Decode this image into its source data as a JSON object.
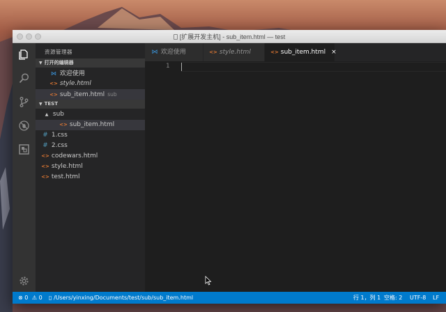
{
  "window": {
    "title": "[扩展开发主机] - sub_item.html — test"
  },
  "activity_bar": {
    "icons": [
      "files-icon",
      "search-icon",
      "source-control-icon",
      "debug-icon",
      "extensions-icon",
      "settings-gear-icon"
    ]
  },
  "sidebar": {
    "title": "资源管理器",
    "open_editors": {
      "header": "打开的编辑器",
      "items": [
        {
          "icon": "vscode-icon",
          "label": "欢迎使用",
          "italic": false,
          "hint": ""
        },
        {
          "icon": "html-icon",
          "label": "style.html",
          "italic": true,
          "hint": ""
        },
        {
          "icon": "html-icon",
          "label": "sub_item.html",
          "italic": false,
          "hint": "sub"
        }
      ]
    },
    "folder": {
      "header": "TEST",
      "items": [
        {
          "icon": "folder-open-icon",
          "label": "sub",
          "depth": 1
        },
        {
          "icon": "html-icon",
          "label": "sub_item.html",
          "depth": 2
        },
        {
          "icon": "css-icon",
          "label": "1.css",
          "depth": 1
        },
        {
          "icon": "css-icon",
          "label": "2.css",
          "depth": 1
        },
        {
          "icon": "html-icon",
          "label": "codewars.html",
          "depth": 1
        },
        {
          "icon": "html-icon",
          "label": "style.html",
          "depth": 1
        },
        {
          "icon": "html-icon",
          "label": "test.html",
          "depth": 1
        }
      ]
    }
  },
  "tabs": [
    {
      "label": "欢迎使用",
      "icon": "vscode-icon",
      "italic": false,
      "active": false
    },
    {
      "label": "style.html",
      "icon": "html-icon",
      "italic": true,
      "active": false
    },
    {
      "label": "sub_item.html",
      "icon": "html-icon",
      "italic": false,
      "active": true,
      "close": "×"
    }
  ],
  "editor": {
    "line_numbers": [
      "1"
    ]
  },
  "status_bar": {
    "errors": "0",
    "warnings": "0",
    "file_path": "/Users/yinxing/Documents/test/sub/sub_item.html",
    "position": "行 1，列 1",
    "indent": "空格: 2",
    "encoding": "UTF-8",
    "eol": "LF"
  },
  "colors": {
    "status_bar": "#007acc",
    "activity_bar": "#333333",
    "sidebar": "#252526",
    "editor": "#1e1e1e",
    "html_icon": "#e37933",
    "css_icon": "#519aba"
  }
}
